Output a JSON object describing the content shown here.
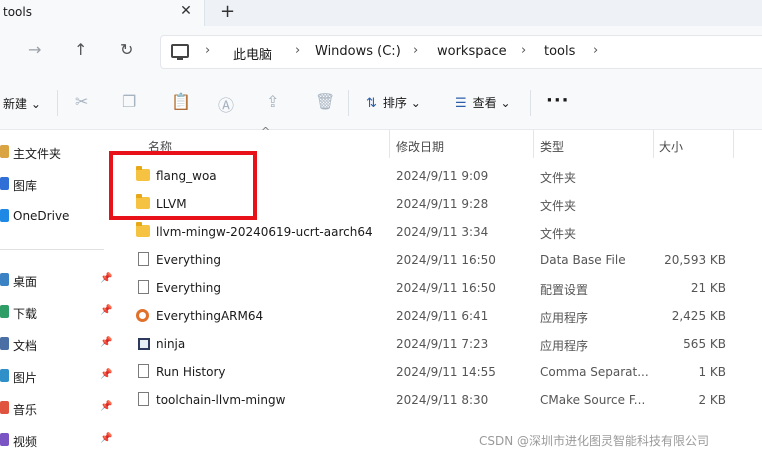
{
  "tab": {
    "title": "tools",
    "close_glyph": "✕",
    "new_glyph": "+"
  },
  "nav": {
    "back_glyph": "←",
    "forward_glyph": "→",
    "up_glyph": "↑",
    "refresh_glyph": "↻",
    "breadcrumbs": [
      "此电脑",
      "Windows (C:)",
      "workspace",
      "tools"
    ],
    "sep_glyph": "›"
  },
  "commands": {
    "new_label": "新建 ⌄",
    "sort_label": "排序 ⌄",
    "view_label": "查看 ⌄",
    "more_glyph": "···",
    "icons": [
      "scissors-icon",
      "copy-icon",
      "paste-icon",
      "rename-icon",
      "share-icon",
      "delete-icon"
    ]
  },
  "sidebar": {
    "items": [
      {
        "label": "主文件夹",
        "color": "#d9a441",
        "pinned": false
      },
      {
        "label": "图库",
        "color": "#2f6fd6",
        "pinned": false
      },
      {
        "label": "OneDrive",
        "color": "#1e88e5",
        "pinned": false
      },
      {
        "label": "桌面",
        "color": "#3b82c4",
        "pinned": true
      },
      {
        "label": "下载",
        "color": "#2f9e66",
        "pinned": true
      },
      {
        "label": "文档",
        "color": "#4a6fa5",
        "pinned": true
      },
      {
        "label": "图片",
        "color": "#2f8fc8",
        "pinned": true
      },
      {
        "label": "音乐",
        "color": "#e0533f",
        "pinned": true
      },
      {
        "label": "视频",
        "color": "#7b54c4",
        "pinned": true
      }
    ],
    "pin_glyph": "📌"
  },
  "columns": {
    "name": "名称",
    "date": "修改日期",
    "type": "类型",
    "size": "大小",
    "sort_glyph": "^"
  },
  "files": [
    {
      "name": "flang_woa",
      "date": "2024/9/11 9:09",
      "type": "文件夹",
      "size": "",
      "icon": "folder"
    },
    {
      "name": "LLVM",
      "date": "2024/9/11 9:28",
      "type": "文件夹",
      "size": "",
      "icon": "folder"
    },
    {
      "name": "llvm-mingw-20240619-ucrt-aarch64",
      "date": "2024/9/11 3:34",
      "type": "文件夹",
      "size": "",
      "icon": "folder"
    },
    {
      "name": "Everything",
      "date": "2024/9/11 16:50",
      "type": "Data Base File",
      "size": "20,593 KB",
      "icon": "doc"
    },
    {
      "name": "Everything",
      "date": "2024/9/11 16:50",
      "type": "配置设置",
      "size": "21 KB",
      "icon": "doc"
    },
    {
      "name": "EverythingARM64",
      "date": "2024/9/11 6:41",
      "type": "应用程序",
      "size": "2,425 KB",
      "icon": "exe"
    },
    {
      "name": "ninja",
      "date": "2024/9/11 7:23",
      "type": "应用程序",
      "size": "565 KB",
      "icon": "ninja"
    },
    {
      "name": "Run History",
      "date": "2024/9/11 14:55",
      "type": "Comma Separat...",
      "size": "1 KB",
      "icon": "doc"
    },
    {
      "name": "toolchain-llvm-mingw",
      "date": "2024/9/11 8:30",
      "type": "CMake Source F...",
      "size": "2 KB",
      "icon": "doc"
    }
  ],
  "watermark": "CSDN @深圳市进化图灵智能科技有限公司",
  "colors": {
    "highlight": "#e8111a",
    "folder": "#f5c242",
    "accent": "#2b5ea8"
  }
}
